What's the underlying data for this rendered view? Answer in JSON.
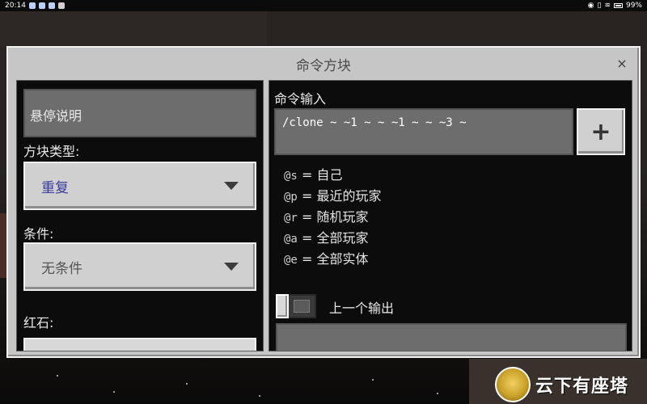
{
  "status_bar": {
    "time": "20:14",
    "battery": "99%"
  },
  "dialog": {
    "title": "命令方块",
    "close_symbol": "×",
    "left_panel": {
      "hover_note_placeholder": "悬停说明",
      "block_type_label": "方块类型:",
      "block_type_value": "重复",
      "condition_label": "条件:",
      "condition_value": "无条件",
      "redstone_label": "红石:"
    },
    "right_panel": {
      "command_input_label": "命令输入",
      "command_value": "/clone ~ ~1 ~ ~ ~1 ~ ~ ~3 ~",
      "add_button_symbol": "+",
      "selectors": [
        {
          "key": "@s",
          "desc": "自己"
        },
        {
          "key": "@p",
          "desc": "最近的玩家"
        },
        {
          "key": "@r",
          "desc": "随机玩家"
        },
        {
          "key": "@a",
          "desc": "全部玩家"
        },
        {
          "key": "@e",
          "desc": "全部实体"
        }
      ],
      "previous_output_label": "上一个输出",
      "previous_output_enabled": false
    }
  },
  "watermark": {
    "text": "云下有座塔"
  },
  "colors": {
    "dialog_bg": "#c6c6c6",
    "panel_bg": "#0c0c0c",
    "input_bg": "#6d6d6d",
    "accent_text": "#3a3aa0"
  }
}
